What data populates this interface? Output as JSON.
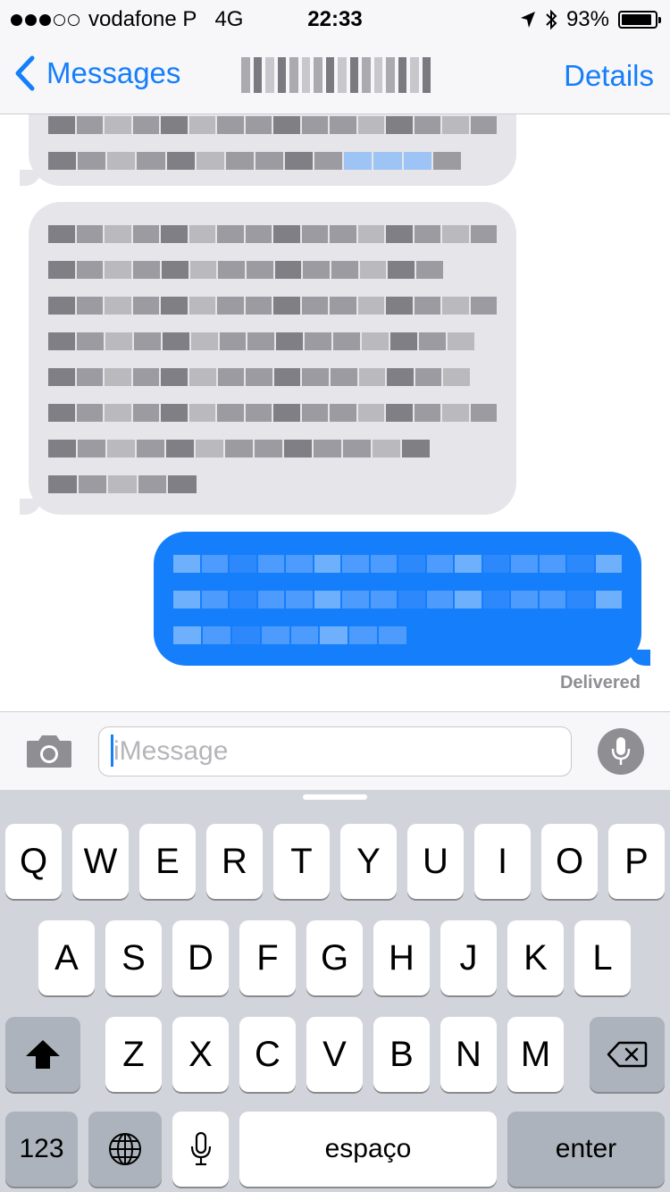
{
  "status_bar": {
    "carrier": "vodafone P",
    "network": "4G",
    "time": "22:33",
    "battery": "93%",
    "battery_level": 0.93
  },
  "nav": {
    "back_label": "Messages",
    "details_label": "Details"
  },
  "conversation": {
    "delivered_label": "Delivered"
  },
  "input": {
    "placeholder": "iMessage"
  },
  "keyboard": {
    "row1": [
      "Q",
      "W",
      "E",
      "R",
      "T",
      "Y",
      "U",
      "I",
      "O",
      "P"
    ],
    "row2": [
      "A",
      "S",
      "D",
      "F",
      "G",
      "H",
      "J",
      "K",
      "L"
    ],
    "row3": [
      "Z",
      "X",
      "C",
      "V",
      "B",
      "N",
      "M"
    ],
    "numbers_label": "123",
    "space_label": "espaço",
    "enter_label": "enter"
  },
  "colors": {
    "accent": "#157efb",
    "received_bubble": "#e5e5ea",
    "keyboard_bg": "#d1d5db"
  }
}
